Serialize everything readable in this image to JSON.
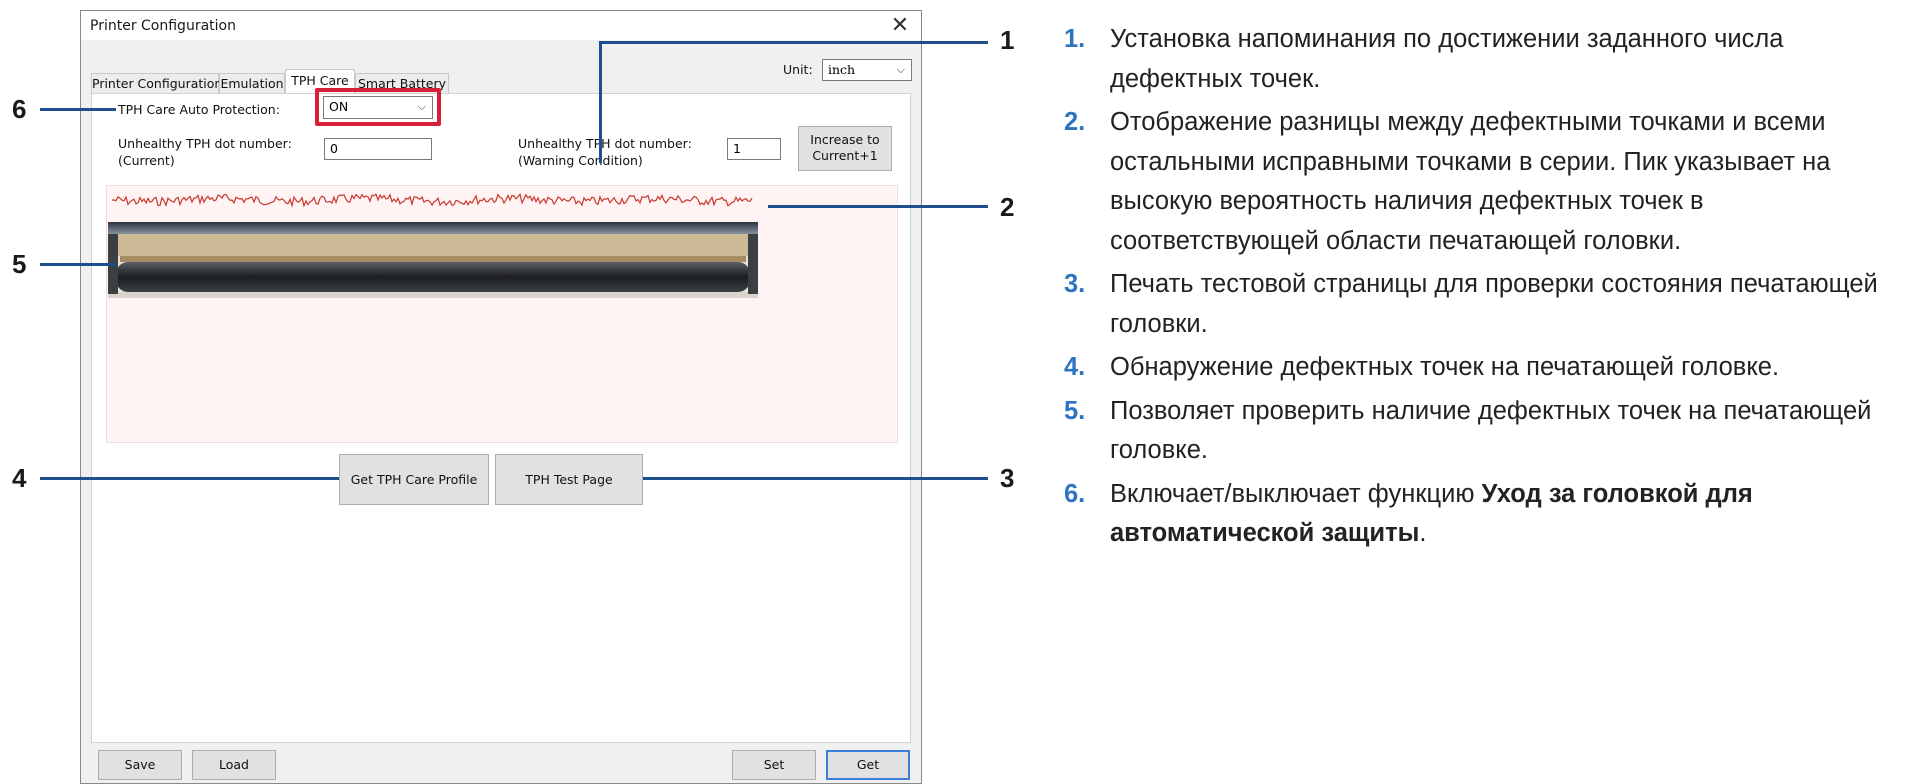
{
  "window": {
    "title": "Printer Configuration",
    "close_glyph": "✕"
  },
  "tabs": [
    {
      "label": "Printer Configuration",
      "active": false
    },
    {
      "label": "Emulation",
      "active": false
    },
    {
      "label": "TPH Care",
      "active": true
    },
    {
      "label": "Smart Battery",
      "active": false
    }
  ],
  "unit": {
    "label": "Unit:",
    "value": "inch"
  },
  "auto_protection": {
    "label": "TPH Care Auto Protection:",
    "value": "ON"
  },
  "unhealthy_current": {
    "label_line1": "Unhealthy TPH dot number:",
    "label_line2": "(Current)",
    "value": "0"
  },
  "unhealthy_warning": {
    "label_line1": "Unhealthy TPH dot number:",
    "label_line2": "(Warning Condition)",
    "value": "1"
  },
  "increase_button": {
    "line1": "Increase to",
    "line2": "Current+1"
  },
  "buttons": {
    "get_profile": "Get TPH Care Profile",
    "test_page": "TPH Test Page",
    "save": "Save",
    "load": "Load",
    "set": "Set",
    "get": "Get"
  },
  "callouts": [
    "1",
    "2",
    "3",
    "4",
    "5",
    "6"
  ],
  "descriptions": [
    {
      "num": "1.",
      "text": "Установка напоминания по достижении заданного числа дефектных точек."
    },
    {
      "num": "2.",
      "text": "Отображение разницы между дефектными точками и всеми остальными исправными точками в серии. Пик указывает на высокую вероятность наличия дефектных точек в соответствующей области печатающей головки."
    },
    {
      "num": "3.",
      "text": "Печать тестовой страницы для проверки состояния печатающей головки."
    },
    {
      "num": "4.",
      "text": "Обнаружение дефектных точек на печатающей головке."
    },
    {
      "num": "5.",
      "text": "Позволяет проверить наличие дефектных точек на печатающей головке."
    },
    {
      "num": "6.",
      "text_before": "Включает/выключает функцию ",
      "text_bold": "Уход за головкой для автоматической защиты",
      "text_after": "."
    }
  ],
  "colors": {
    "accent_blue": "#2f74c0",
    "callout_line": "#1f4e8c",
    "highlight_red": "#d6203a",
    "waveform_red": "#c8382e"
  }
}
